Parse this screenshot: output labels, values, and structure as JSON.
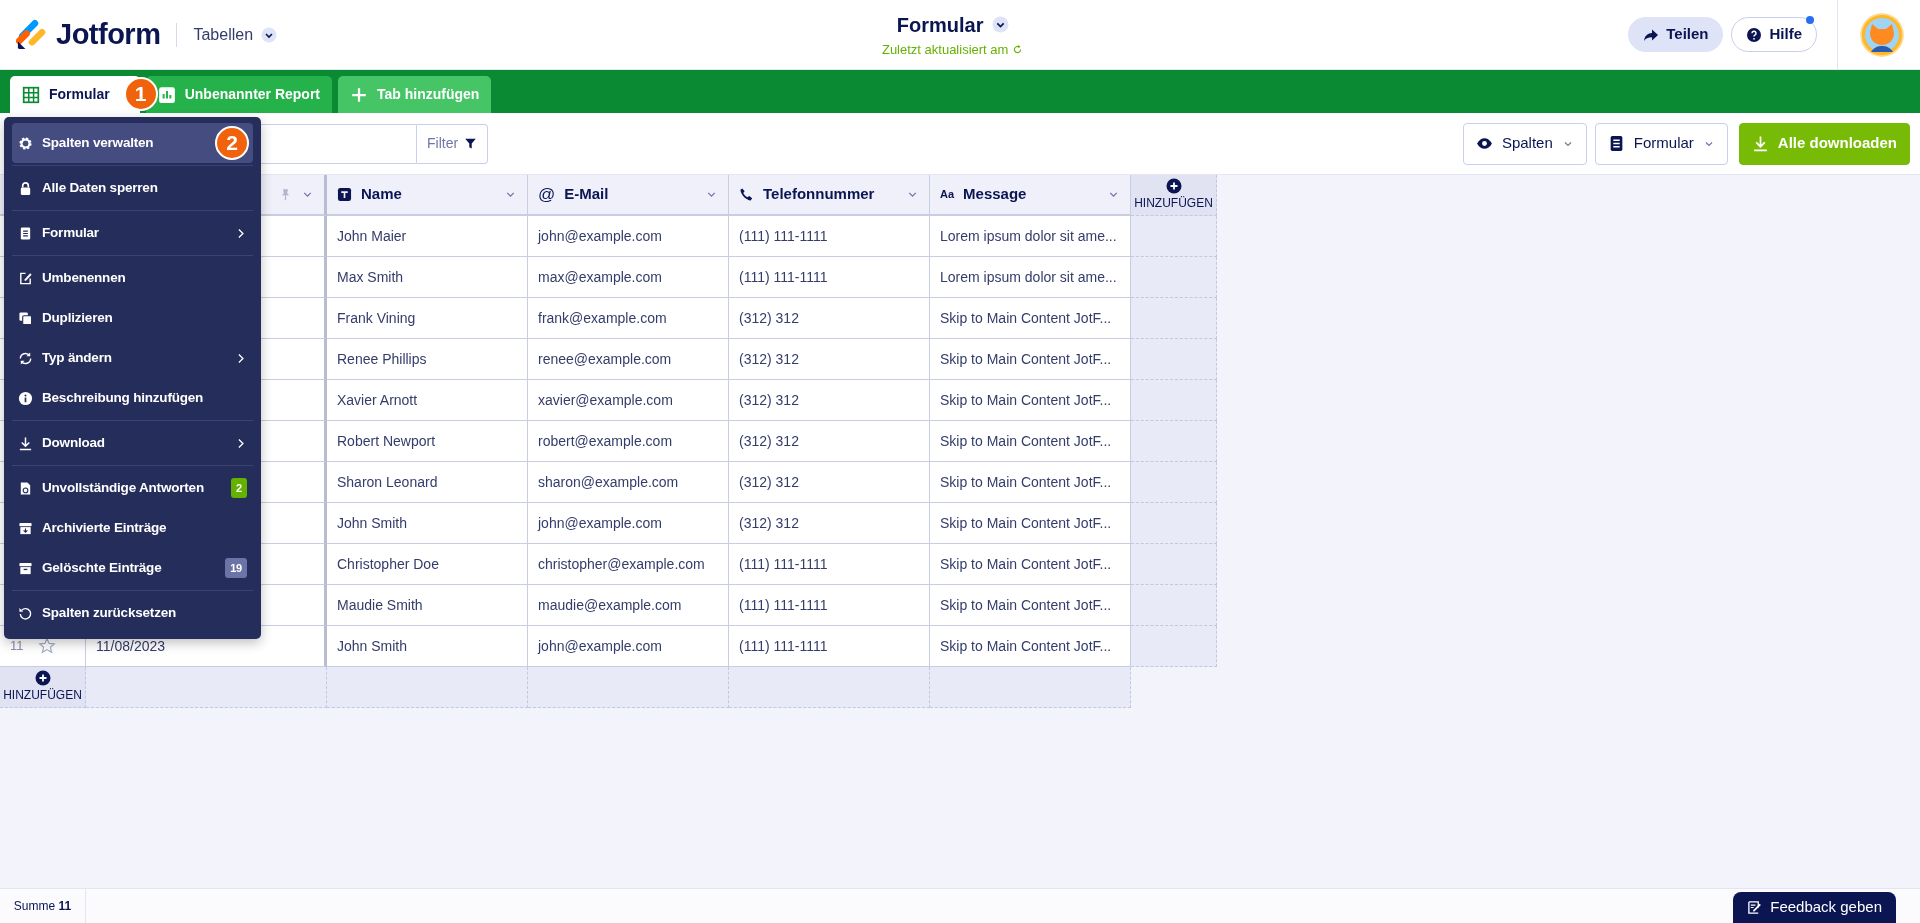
{
  "header": {
    "logo": "Jotform",
    "workspace_menu": "Tabellen",
    "title": "Formular",
    "subtitle": "Zuletzt aktualisiert am",
    "buttons": [
      {
        "label": "Teilen",
        "kind": "share",
        "notification": false
      },
      {
        "label": "Hilfe",
        "kind": "help",
        "notification": true
      }
    ]
  },
  "tabs": [
    {
      "label": "Formular",
      "kind": "table",
      "selected": true,
      "callout": "1"
    },
    {
      "label": "Unbenannter Report",
      "kind": "report",
      "selected": false
    },
    {
      "label": "Tab hinzufügen",
      "kind": "add",
      "selected": false
    }
  ],
  "toolbar": {
    "filter": "Filter",
    "buttons": [
      {
        "label": "Spalten",
        "kind": "eye"
      },
      {
        "label": "Formular",
        "kind": "form"
      },
      {
        "label": "Alle downloaden",
        "kind": "download"
      }
    ]
  },
  "table": {
    "columns": [
      {
        "kind": "date",
        "pinned": true
      },
      {
        "kind": "text",
        "label": "Name"
      },
      {
        "kind": "email",
        "label": "E-Mail",
        "icon_text": "@"
      },
      {
        "kind": "phone",
        "label": "Telefonnummer"
      },
      {
        "kind": "textarea",
        "label": "Message",
        "icon_text": "Aa"
      },
      {
        "kind": "add",
        "label": "HINZUFÜGEN"
      }
    ],
    "rows": [
      {
        "name": "John Maier",
        "email": "john@example.com",
        "phone": "(111) 111-1111",
        "message": "Lorem ipsum dolor sit ame..."
      },
      {
        "name": "Max Smith",
        "email": "max@example.com",
        "phone": "(111) 111-1111",
        "message": "Lorem ipsum dolor sit ame..."
      },
      {
        "name": "Frank Vining",
        "email": "frank@example.com",
        "phone": "(312) 312",
        "message": "Skip to Main Content JotF..."
      },
      {
        "name": "Renee Phillips",
        "email": "renee@example.com",
        "phone": "(312) 312",
        "message": "Skip to Main Content JotF..."
      },
      {
        "name": "Xavier Arnott",
        "email": "xavier@example.com",
        "phone": "(312) 312",
        "message": "Skip to Main Content JotF..."
      },
      {
        "name": "Robert Newport",
        "email": "robert@example.com",
        "phone": "(312) 312",
        "message": "Skip to Main Content JotF..."
      },
      {
        "name": "Sharon Leonard",
        "email": "sharon@example.com",
        "phone": "(312) 312",
        "message": "Skip to Main Content JotF..."
      },
      {
        "name": "John Smith",
        "email": "john@example.com",
        "phone": "(312) 312",
        "message": "Skip to Main Content JotF..."
      },
      {
        "name": "Christopher Doe",
        "email": "christopher@example.com",
        "phone": "(111) 111-1111",
        "message": "Skip to Main Content JotF..."
      },
      {
        "name": "Maudie Smith",
        "email": "maudie@example.com",
        "phone": "(111) 111-1111",
        "message": "Skip to Main Content JotF..."
      },
      {
        "number": "11",
        "starred": false,
        "date": "11/08/2023",
        "name": "John Smith",
        "email": "john@example.com",
        "phone": "(111) 111-1111",
        "message": "Skip to Main Content JotF..."
      }
    ],
    "add_row": {
      "label": "HINZUFÜGEN"
    }
  },
  "menu": {
    "groups": [
      [
        {
          "label": "Spalten verwalten",
          "kind": "settings",
          "selected": true,
          "callout": "2"
        }
      ],
      [
        {
          "label": "Alle Daten sperren",
          "kind": "lock",
          "selected": false
        }
      ],
      [
        {
          "label": "Formular",
          "kind": "form",
          "selected": false,
          "submenu": true
        }
      ],
      [
        {
          "label": "Umbenennen",
          "kind": "rename",
          "selected": false
        },
        {
          "label": "Duplizieren",
          "kind": "duplicate",
          "selected": false
        },
        {
          "label": "Typ ändern",
          "kind": "type",
          "selected": false,
          "submenu": true
        },
        {
          "label": "Beschreibung hinzufügen",
          "kind": "info",
          "selected": false
        }
      ],
      [
        {
          "label": "Download",
          "kind": "download",
          "selected": false,
          "submenu": true
        }
      ],
      [
        {
          "label": "Unvollständige Antworten",
          "kind": "incomplete",
          "selected": false,
          "badge": "2",
          "color": "#64b200"
        },
        {
          "label": "Archivierte Einträge",
          "kind": "archive",
          "selected": false
        },
        {
          "label": "Gelöschte Einträge",
          "kind": "trash",
          "selected": false,
          "badge": "19",
          "color": "#6c73a6"
        }
      ],
      [
        {
          "label": "Spalten zurücksetzen",
          "kind": "reset",
          "selected": false
        }
      ]
    ]
  },
  "footer": {
    "sum": "Summe **11**",
    "feedback": "Feedback geben"
  }
}
